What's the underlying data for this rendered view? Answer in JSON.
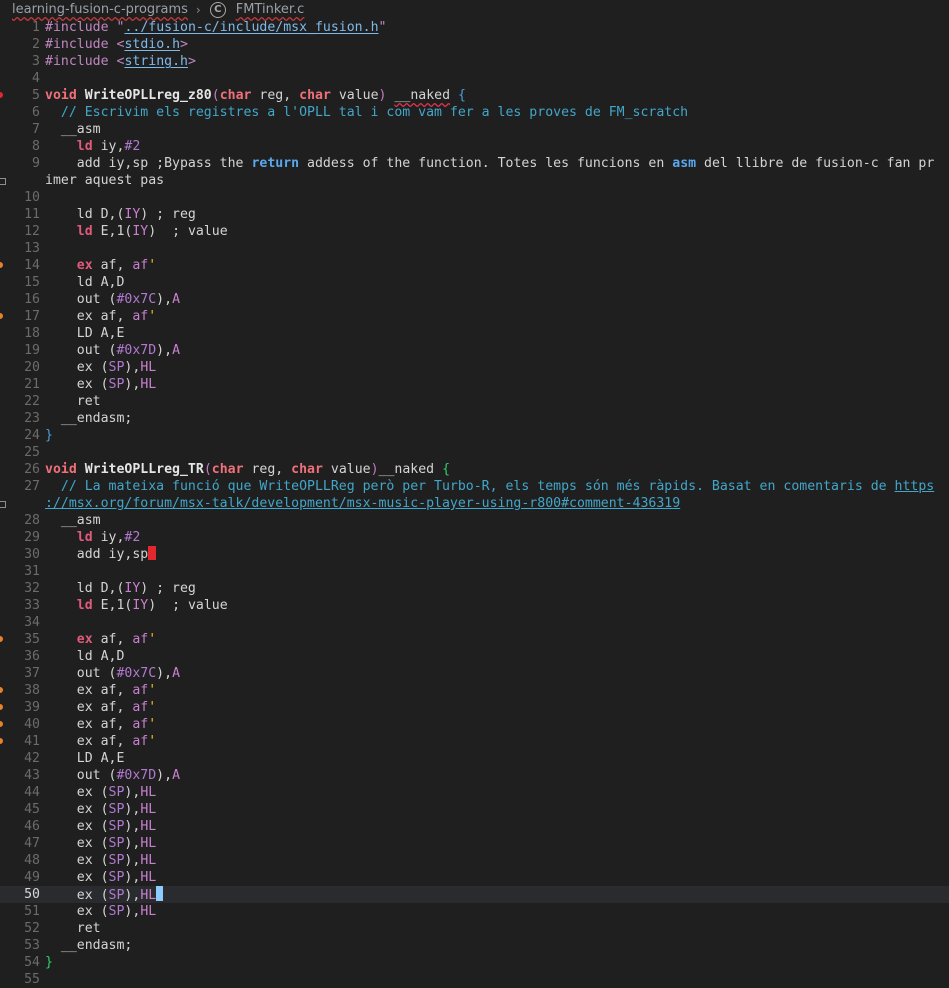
{
  "breadcrumb": {
    "folder": "learning-fusion-c-programs",
    "separator": "›",
    "file_icon": "C",
    "file": "FMTinker.c"
  },
  "editor": {
    "active_line": 50,
    "lines": [
      {
        "n": "1",
        "t": "#include \"../fusion-c/include/msx_fusion.h\""
      },
      {
        "n": "2",
        "t": "#include <stdio.h>"
      },
      {
        "n": "3",
        "t": "#include <string.h>"
      },
      {
        "n": "4",
        "t": ""
      },
      {
        "n": "5",
        "t": "void WriteOPLLreg_z80(char reg, char value) __naked {"
      },
      {
        "n": "6",
        "t": "  // Escrivim els registres a l'OPLL tal i com vam fer a les proves de FM_scratch"
      },
      {
        "n": "7",
        "t": "  __asm"
      },
      {
        "n": "8",
        "t": "    ld iy,#2"
      },
      {
        "n": "9",
        "t": "    add iy,sp ;Bypass the return addess of the function. Totes les funcions en asm del llibre de fusion-c fan pr"
      },
      {
        "n": "",
        "t": "imer aquest pas"
      },
      {
        "n": "10",
        "t": ""
      },
      {
        "n": "11",
        "t": "    ld D,(IY) ; reg"
      },
      {
        "n": "12",
        "t": "    ld E,1(IY)  ; value"
      },
      {
        "n": "13",
        "t": ""
      },
      {
        "n": "14",
        "t": "    ex af, af'"
      },
      {
        "n": "15",
        "t": "    ld A,D"
      },
      {
        "n": "16",
        "t": "    out (#0x7C),A"
      },
      {
        "n": "17",
        "t": "    ex af, af'"
      },
      {
        "n": "18",
        "t": "    LD A,E"
      },
      {
        "n": "19",
        "t": "    out (#0x7D),A"
      },
      {
        "n": "20",
        "t": "    ex (SP),HL"
      },
      {
        "n": "21",
        "t": "    ex (SP),HL"
      },
      {
        "n": "22",
        "t": "    ret"
      },
      {
        "n": "23",
        "t": "  __endasm;"
      },
      {
        "n": "24",
        "t": "}"
      },
      {
        "n": "25",
        "t": ""
      },
      {
        "n": "26",
        "t": "void WriteOPLLreg_TR(char reg, char value)__naked {"
      },
      {
        "n": "27",
        "t": "  // La mateixa funció que WriteOPLLReg però per Turbo-R, els temps són més ràpids. Basat en comentaris de https"
      },
      {
        "n": "",
        "t": "://msx.org/forum/msx-talk/development/msx-music-player-using-r800#comment-436319"
      },
      {
        "n": "28",
        "t": "  __asm"
      },
      {
        "n": "29",
        "t": "    ld iy,#2"
      },
      {
        "n": "30",
        "t": "    add iy,sp"
      },
      {
        "n": "31",
        "t": ""
      },
      {
        "n": "32",
        "t": "    ld D,(IY) ; reg"
      },
      {
        "n": "33",
        "t": "    ld E,1(IY)  ; value"
      },
      {
        "n": "34",
        "t": ""
      },
      {
        "n": "35",
        "t": "    ex af, af'"
      },
      {
        "n": "36",
        "t": "    ld A,D"
      },
      {
        "n": "37",
        "t": "    out (#0x7C),A"
      },
      {
        "n": "38",
        "t": "    ex af, af'"
      },
      {
        "n": "39",
        "t": "    ex af, af'"
      },
      {
        "n": "40",
        "t": "    ex af, af'"
      },
      {
        "n": "41",
        "t": "    ex af, af'"
      },
      {
        "n": "42",
        "t": "    LD A,E"
      },
      {
        "n": "43",
        "t": "    out (#0x7D),A"
      },
      {
        "n": "44",
        "t": "    ex (SP),HL"
      },
      {
        "n": "45",
        "t": "    ex (SP),HL"
      },
      {
        "n": "46",
        "t": "    ex (SP),HL"
      },
      {
        "n": "47",
        "t": "    ex (SP),HL"
      },
      {
        "n": "48",
        "t": "    ex (SP),HL"
      },
      {
        "n": "49",
        "t": "    ex (SP),HL"
      },
      {
        "n": "50",
        "t": "    ex (SP),HL"
      },
      {
        "n": "51",
        "t": "    ex (SP),HL"
      },
      {
        "n": "52",
        "t": "    ret"
      },
      {
        "n": "53",
        "t": "  __endasm;"
      },
      {
        "n": "54",
        "t": "}"
      },
      {
        "n": "55",
        "t": ""
      }
    ]
  },
  "colors": {
    "background": "#1f1f20",
    "line_number": "#6b6b6b",
    "comment": "#42a6c8",
    "keyword": "#f0707a",
    "error_marker": "#e0282e",
    "cursor": "#8ecbff",
    "warning_marker": "#e8822a"
  },
  "markers": [
    {
      "line": "5",
      "kind": "error"
    },
    {
      "line": "14",
      "kind": "warning"
    },
    {
      "line": "17",
      "kind": "warning"
    },
    {
      "line": "35",
      "kind": "warning"
    },
    {
      "line": "38",
      "kind": "warning"
    },
    {
      "line": "39",
      "kind": "warning"
    },
    {
      "line": "40",
      "kind": "warning"
    },
    {
      "line": "41",
      "kind": "warning"
    }
  ]
}
